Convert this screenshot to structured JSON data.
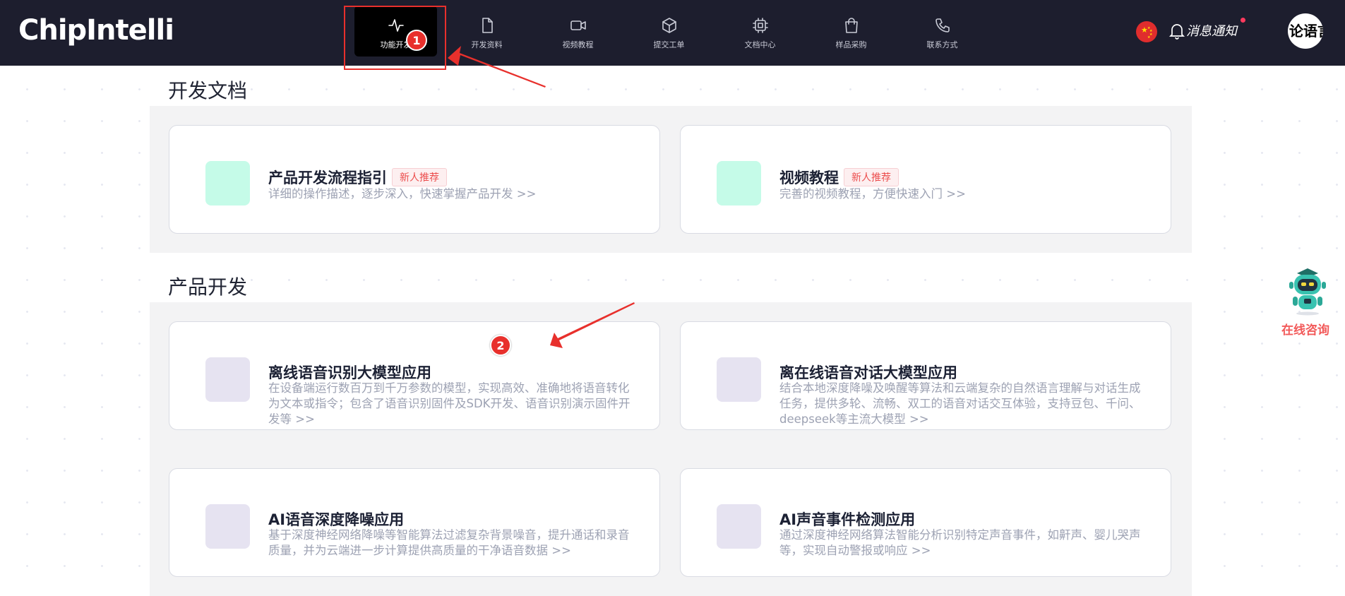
{
  "header": {
    "logo": "ChipIntelli",
    "nav": [
      {
        "label": "功能开发",
        "icon": "activity-icon",
        "active": true
      },
      {
        "label": "开发资料",
        "icon": "file-icon"
      },
      {
        "label": "视频教程",
        "icon": "video-icon"
      },
      {
        "label": "提交工单",
        "icon": "box-icon"
      },
      {
        "label": "文档中心",
        "icon": "chip-icon"
      },
      {
        "label": "样品采购",
        "icon": "shopping-bag-icon"
      },
      {
        "label": "联系方式",
        "icon": "phone-icon"
      }
    ],
    "notification_label": "消息通知",
    "language_label": "论语言",
    "flag": "china-flag-icon"
  },
  "dev_docs": {
    "title": "开发文档",
    "cards": [
      {
        "title": "产品开发流程指引",
        "badge": "新人推荐",
        "desc": "详细的操作描述，逐步深入，快速掌握产品开发 >>",
        "icon_color": "#c5fbe8"
      },
      {
        "title": "视频教程",
        "badge": "新人推荐",
        "desc": "完善的视频教程，方便快速入门 >>",
        "icon_color": "#c5fbe8"
      }
    ]
  },
  "product_dev": {
    "title": "产品开发",
    "cards": [
      {
        "title": "离线语音识别大模型应用",
        "desc": "在设备端运行数百万到千万参数的模型，实现高效、准确地将语音转化为文本或指令；包含了语音识别固件及SDK开发、语音识别演示固件开发等 >>",
        "icon_color": "#e6e3f1"
      },
      {
        "title": "离在线语音对话大模型应用",
        "desc": "结合本地深度降噪及唤醒等算法和云端复杂的自然语言理解与对话生成任务，提供多轮、流畅、双工的语音对话交互体验，支持豆包、千问、deepseek等主流大模型 >>",
        "icon_color": "#e6e3f1"
      },
      {
        "title": "AI语音深度降噪应用",
        "desc": "基于深度神经网络降噪等智能算法过滤复杂背景噪音，提升通话和录音质量，并为云端进一步计算提供高质量的干净语音数据 >>",
        "icon_color": "#e6e3f1"
      },
      {
        "title": "AI声音事件检测应用",
        "desc": "通过深度神经网络算法智能分析识别特定声音事件，如鼾声、婴儿哭声等，实现自动警报或响应 >>",
        "icon_color": "#e6e3f1"
      }
    ]
  },
  "assistant": {
    "label": "在线咨询",
    "icon": "robot-icon"
  },
  "annotations": {
    "step1": "1",
    "step2": "2",
    "color": "#e8302c"
  }
}
